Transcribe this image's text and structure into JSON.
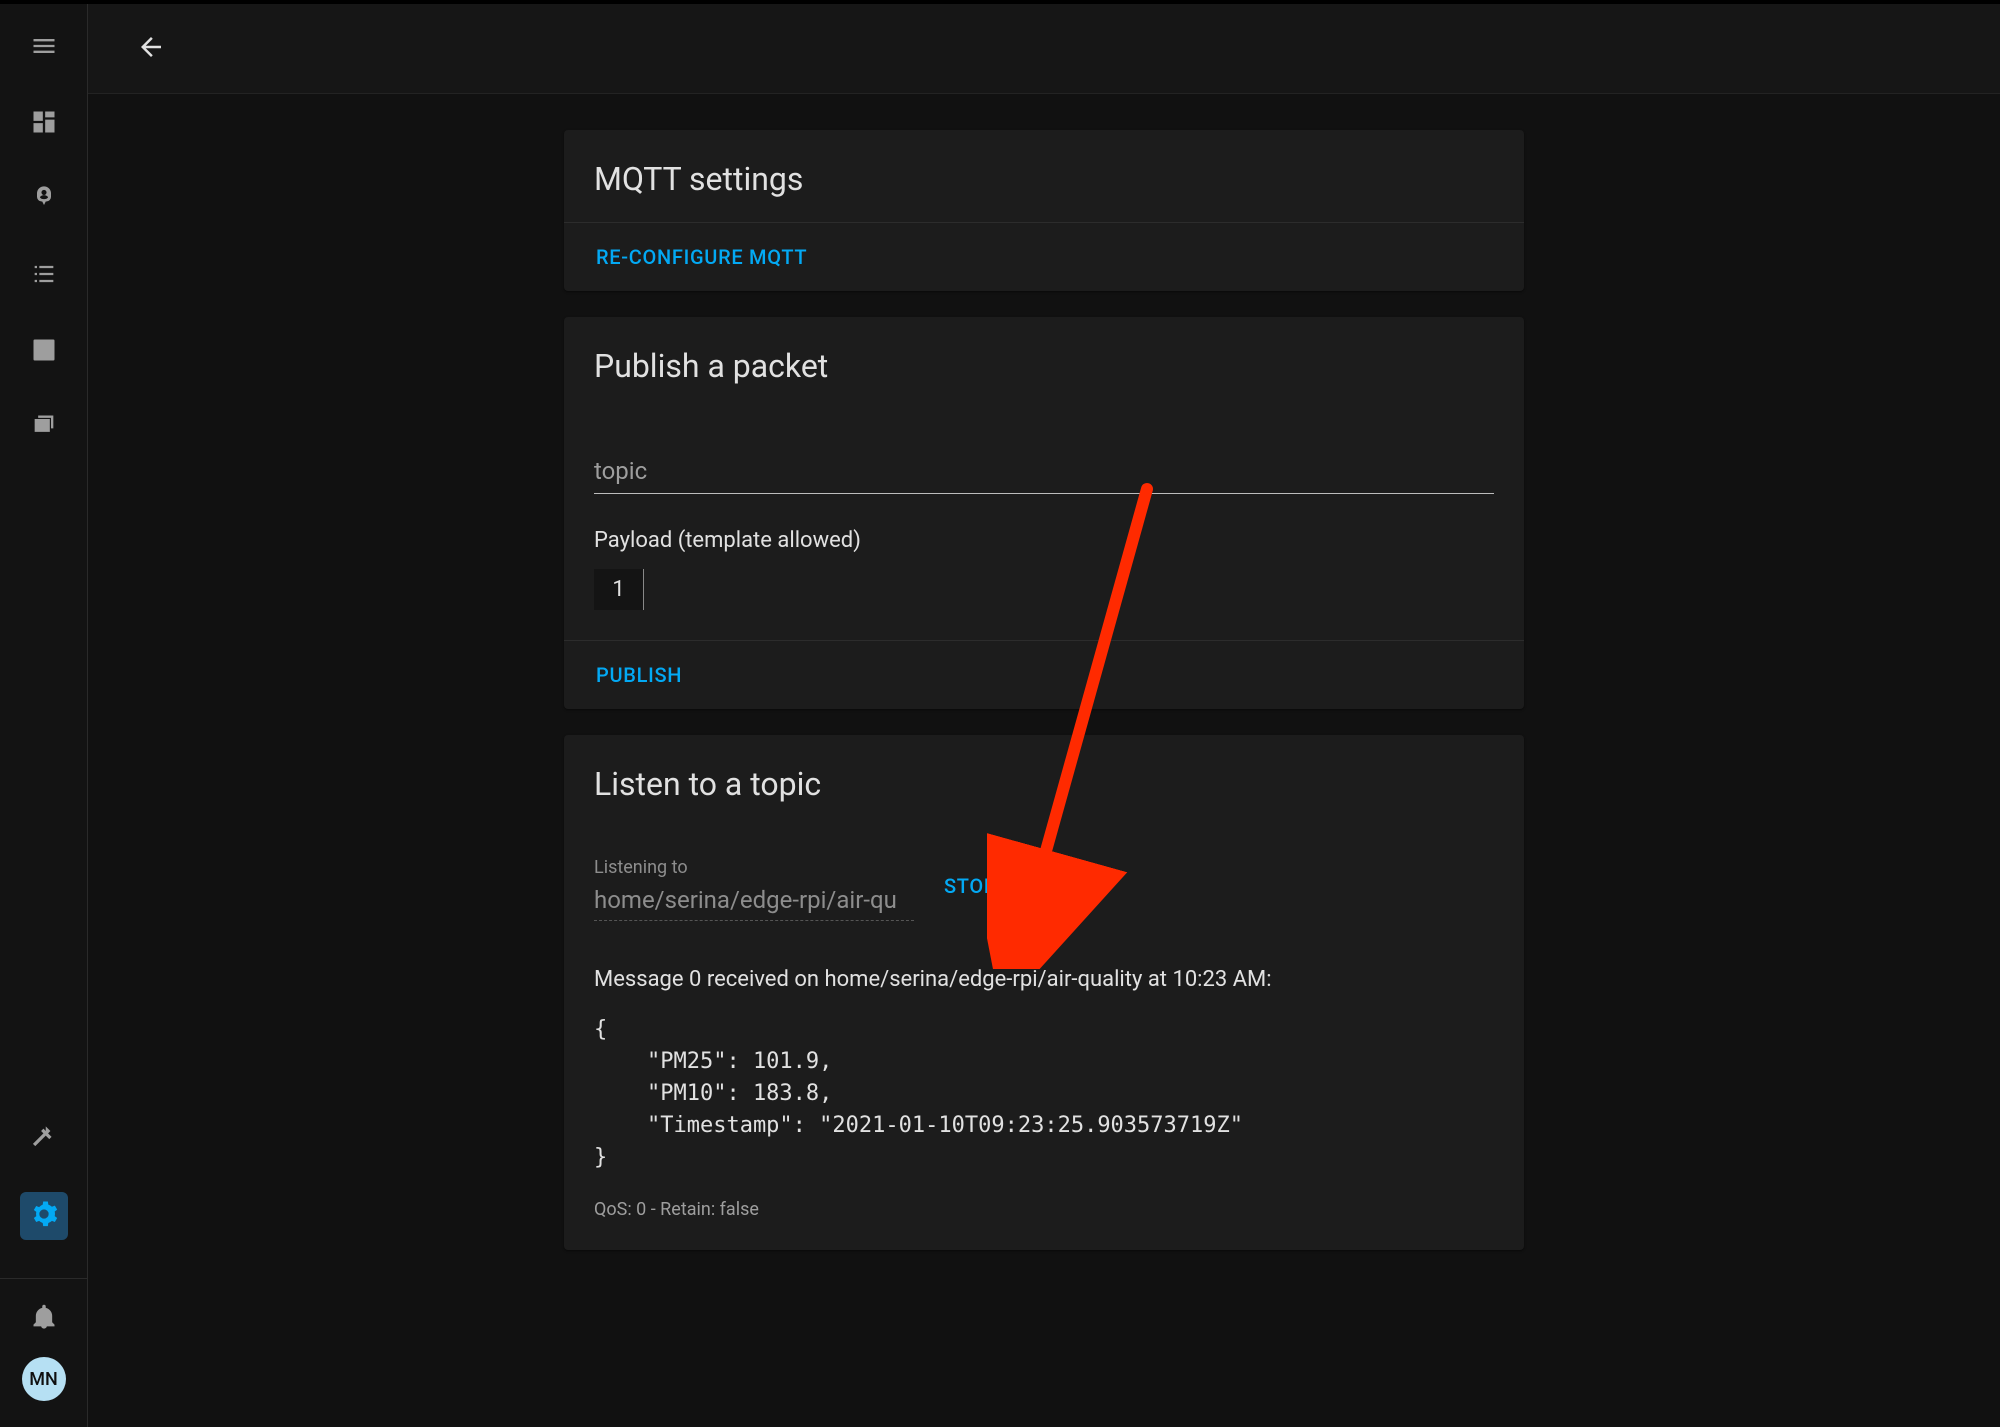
{
  "user": {
    "initials": "MN"
  },
  "mqtt_card": {
    "title": "MQTT settings",
    "reconfigure_label": "RE-CONFIGURE MQTT"
  },
  "publish_card": {
    "title": "Publish a packet",
    "topic_placeholder": "topic",
    "topic_value": "",
    "payload_label": "Payload (template allowed)",
    "payload_value": "1",
    "publish_label": "PUBLISH"
  },
  "listen_card": {
    "title": "Listen to a topic",
    "listening_label": "Listening to",
    "listening_value": "home/serina/edge-rpi/air-qu",
    "stop_label": "STOP LISTENING",
    "message_summary": "Message 0 received on home/serina/edge-rpi/air-quality at 10:23 AM:",
    "message_body": "{\n    \"PM25\": 101.9,\n    \"PM10\": 183.8,\n    \"Timestamp\": \"2021-01-10T09:23:25.903573719Z\"\n}",
    "qos_line": "QoS: 0 - Retain: false"
  }
}
